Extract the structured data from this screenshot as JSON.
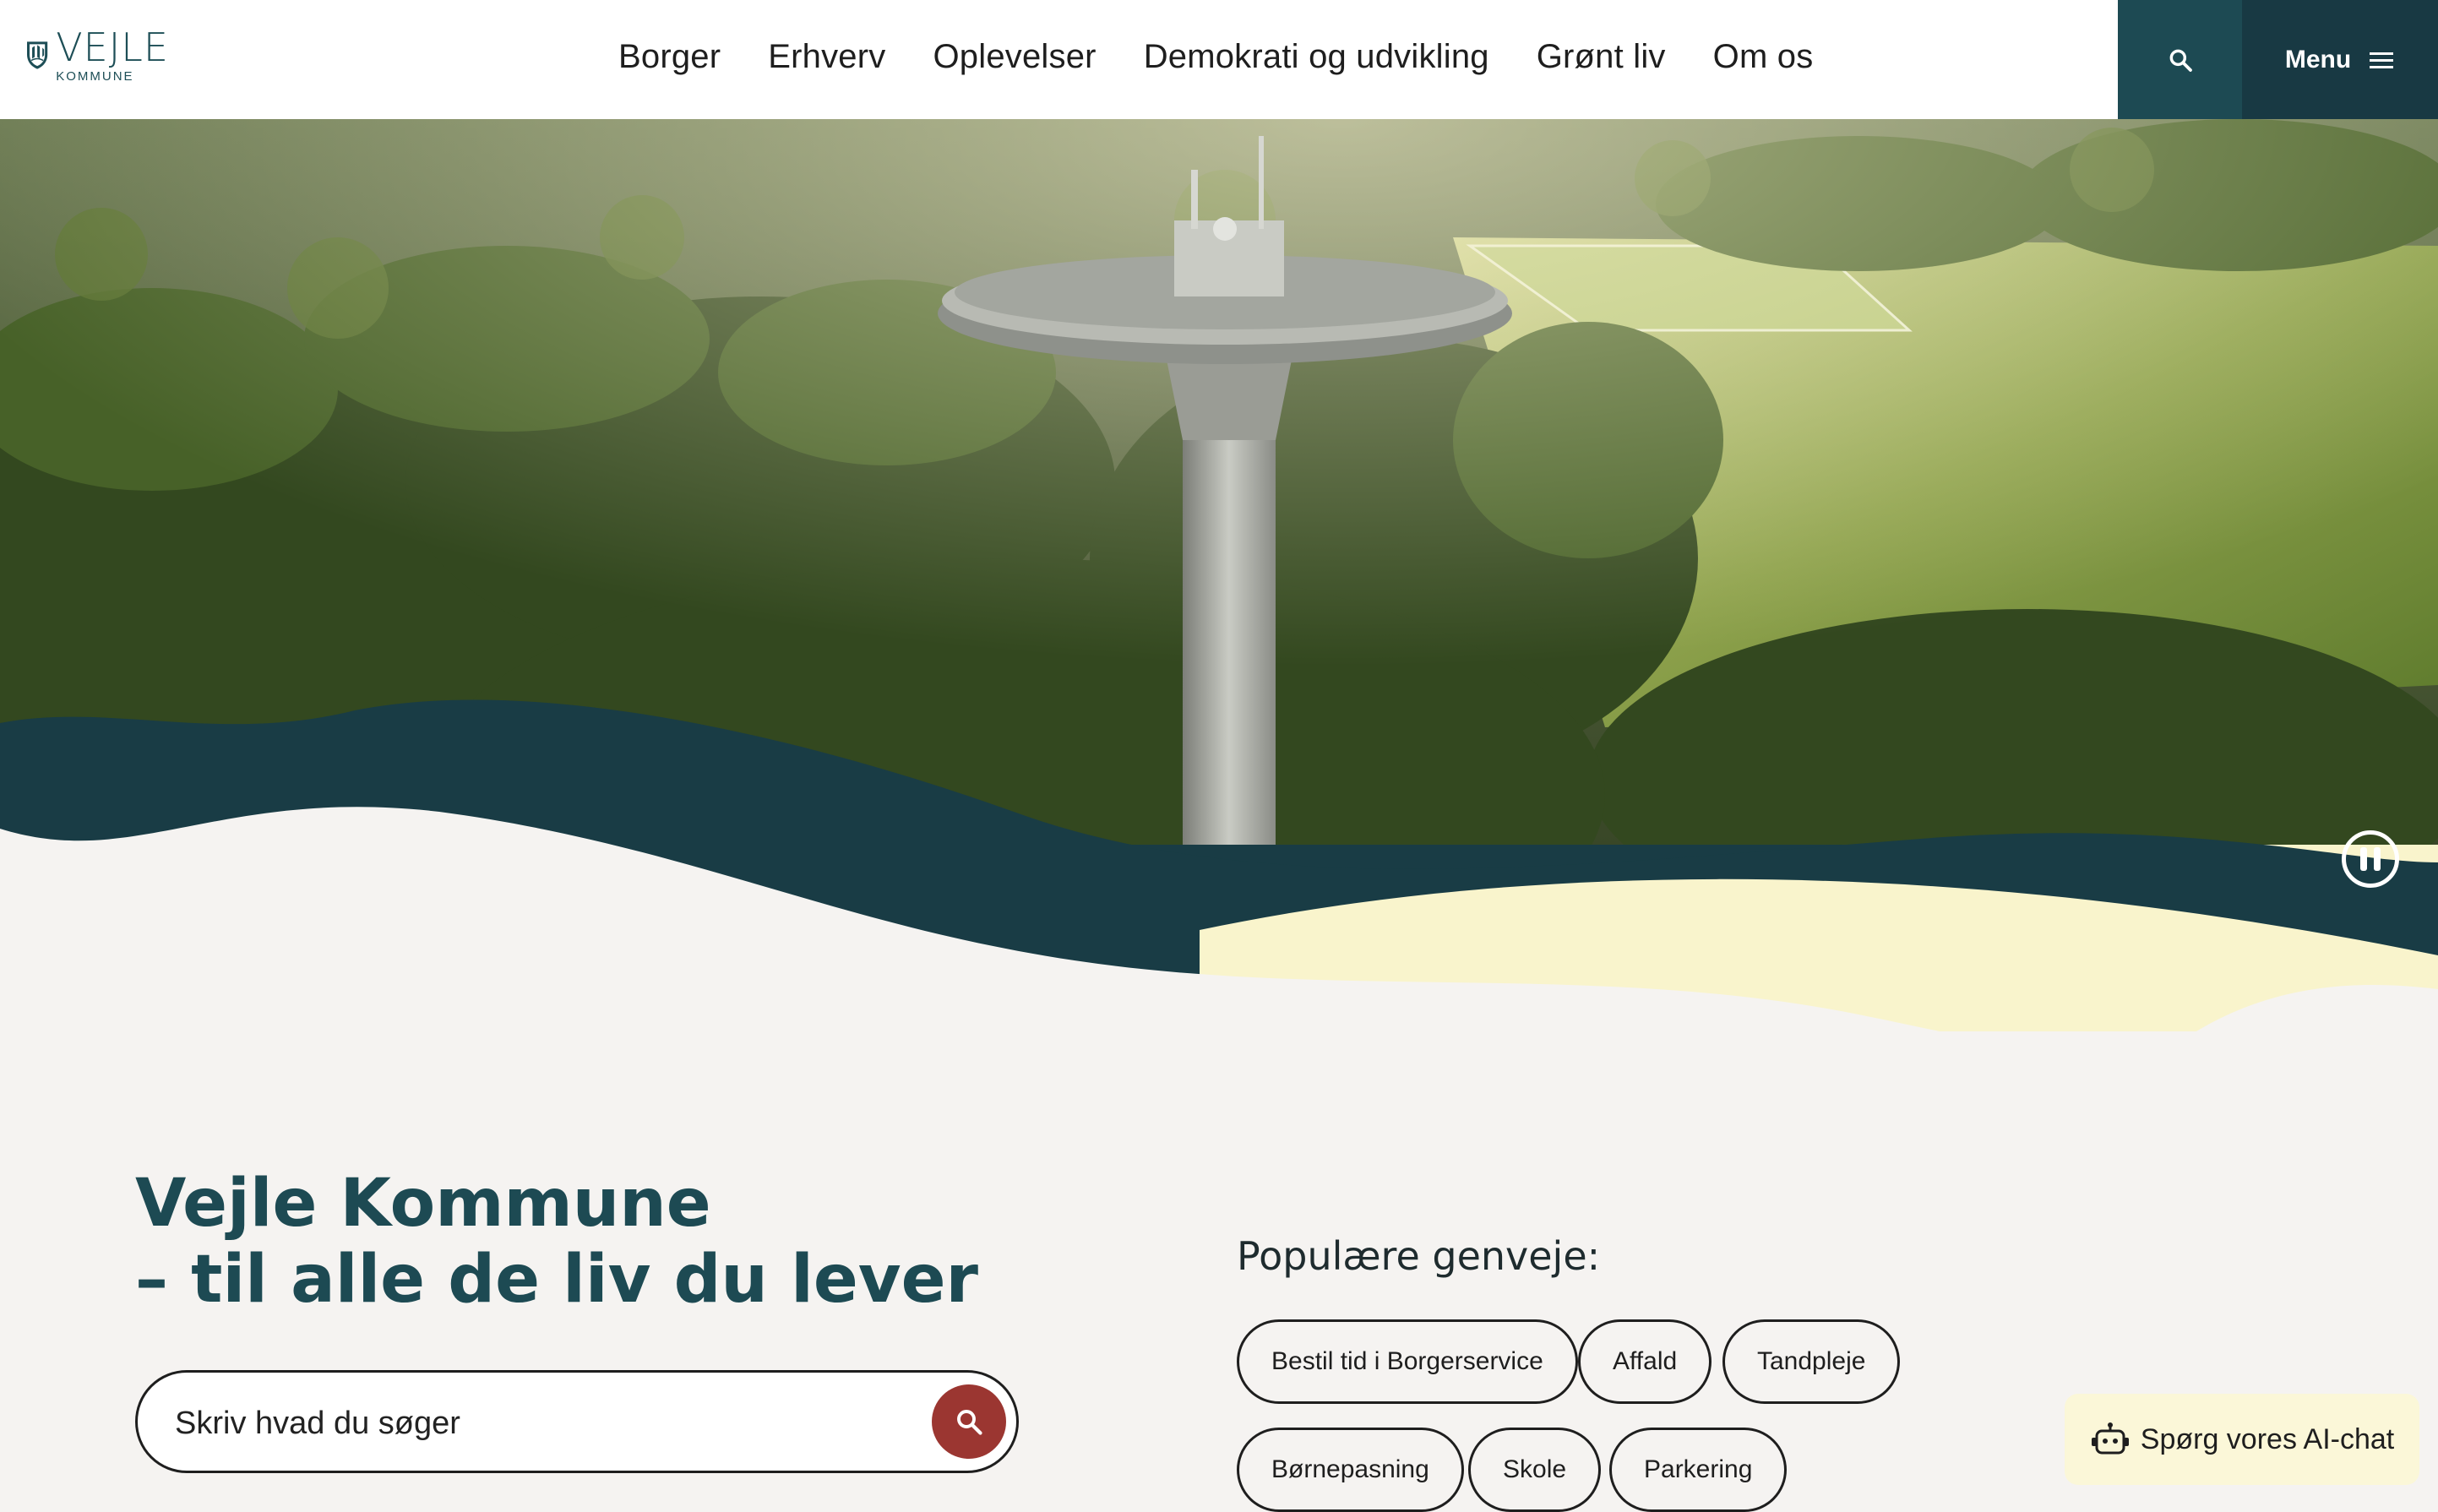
{
  "header": {
    "logo": {
      "word": "VEJLE",
      "sub": "KOMMUNE",
      "icon": "municipal-crest"
    },
    "nav": [
      {
        "label": "Borger"
      },
      {
        "label": "Erhverv"
      },
      {
        "label": "Oplevelser"
      },
      {
        "label": "Demokrati og udvikling"
      },
      {
        "label": "Grønt liv"
      },
      {
        "label": "Om os"
      }
    ],
    "search_icon": "search-icon",
    "menu_label": "Menu"
  },
  "hero": {
    "pause_icon": "pause-icon",
    "colors": {
      "dark_wave": "#193c45",
      "cream_wave": "#f9f4cc",
      "background": "#f5f3f1"
    }
  },
  "main": {
    "title_line1": "Vejle Kommune",
    "title_line2": "– til alle de liv du lever",
    "search": {
      "placeholder": "Skriv hvad du søger",
      "value": ""
    }
  },
  "shortcuts": {
    "title": "Populære genveje:",
    "items": [
      {
        "label": "Bestil tid i Borgerservice"
      },
      {
        "label": "Affald"
      },
      {
        "label": "Tandpleje"
      },
      {
        "label": "Børnepasning"
      },
      {
        "label": "Skole"
      },
      {
        "label": "Parkering"
      }
    ]
  },
  "ai_chat": {
    "label": "Spørg vores AI-chat",
    "icon": "robot-icon"
  },
  "colors": {
    "primary": "#1d4a53",
    "accent_red": "#9b3631"
  }
}
